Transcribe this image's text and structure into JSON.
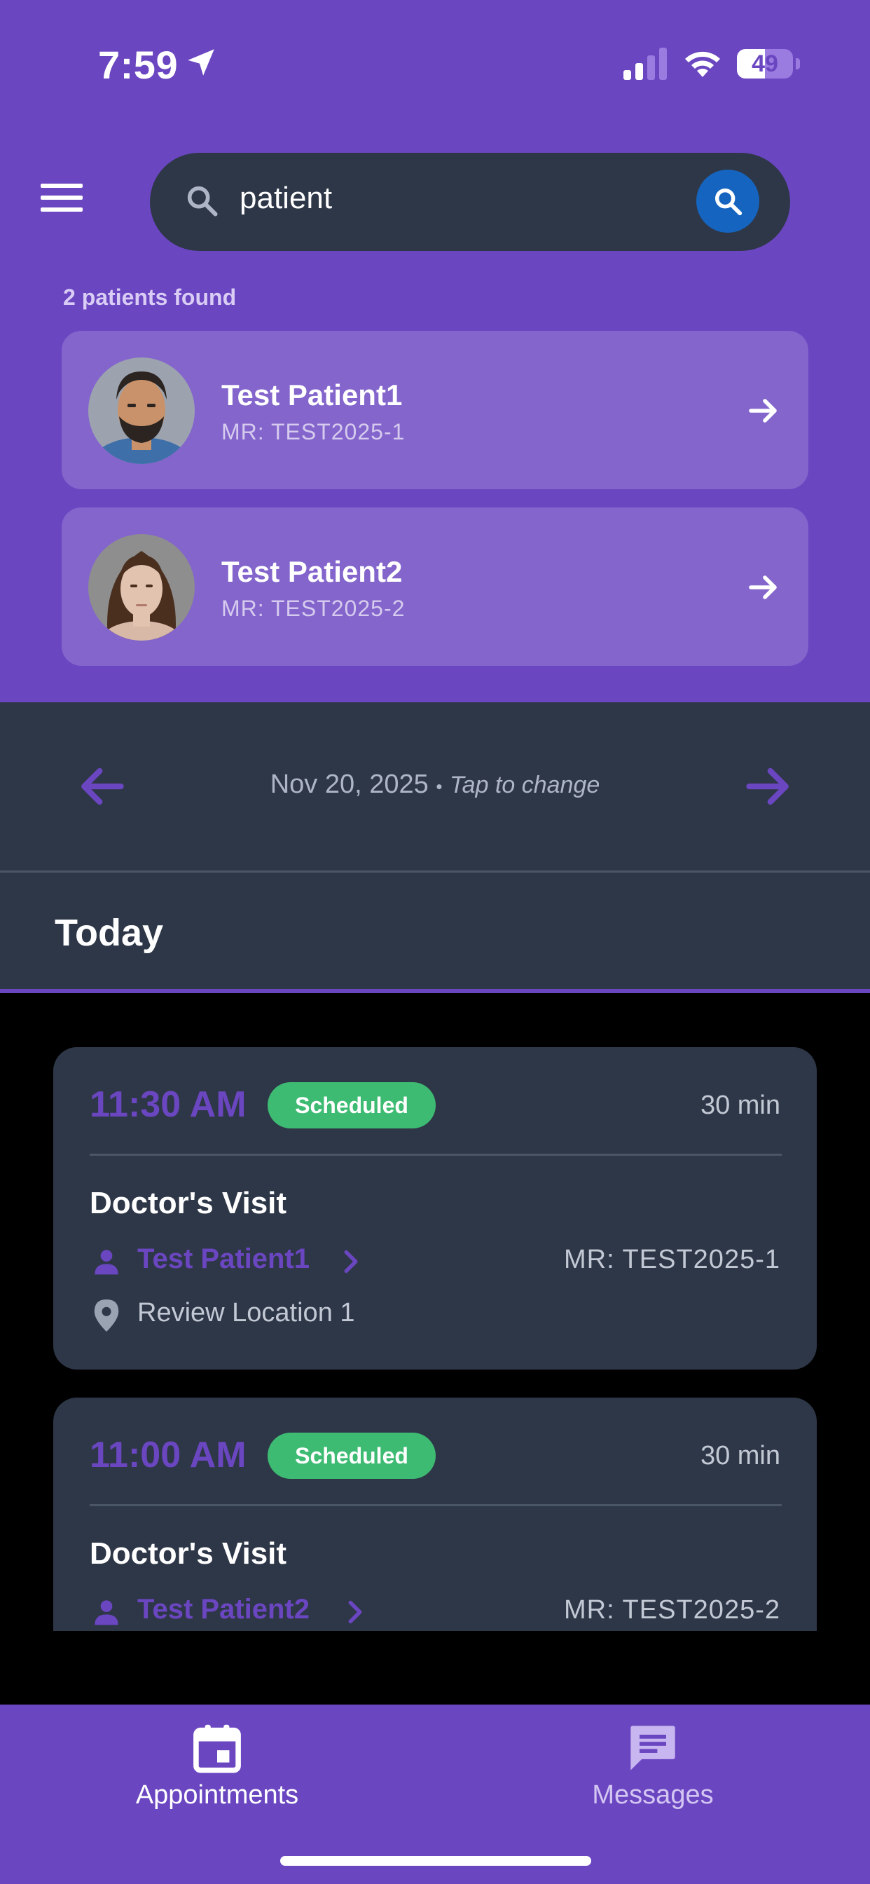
{
  "status_bar": {
    "time": "7:59",
    "battery": "49"
  },
  "search": {
    "query": "patient"
  },
  "results": {
    "count_label": "2 patients found",
    "patients": [
      {
        "name": "Test Patient1",
        "mr": "MR: TEST2025-1"
      },
      {
        "name": "Test Patient2",
        "mr": "MR: TEST2025-2"
      }
    ]
  },
  "date_nav": {
    "date": "Nov 20, 2025",
    "separator": "•",
    "hint": "Tap to change"
  },
  "section": {
    "title": "Today"
  },
  "appointments": [
    {
      "time": "11:30 AM",
      "status": "Scheduled",
      "duration": "30 min",
      "title": "Doctor's Visit",
      "patient": "Test Patient1",
      "mr": "MR: TEST2025-1",
      "location": "Review Location 1"
    },
    {
      "time": "11:00 AM",
      "status": "Scheduled",
      "duration": "30 min",
      "title": "Doctor's Visit",
      "patient": "Test Patient2",
      "mr": "MR: TEST2025-2"
    }
  ],
  "bottom_nav": {
    "appointments": "Appointments",
    "messages": "Messages"
  },
  "colors": {
    "accent": "#6B46C1",
    "card": "#2E3748",
    "status_scheduled": "#3EBB72",
    "search_button": "#1565C0"
  }
}
